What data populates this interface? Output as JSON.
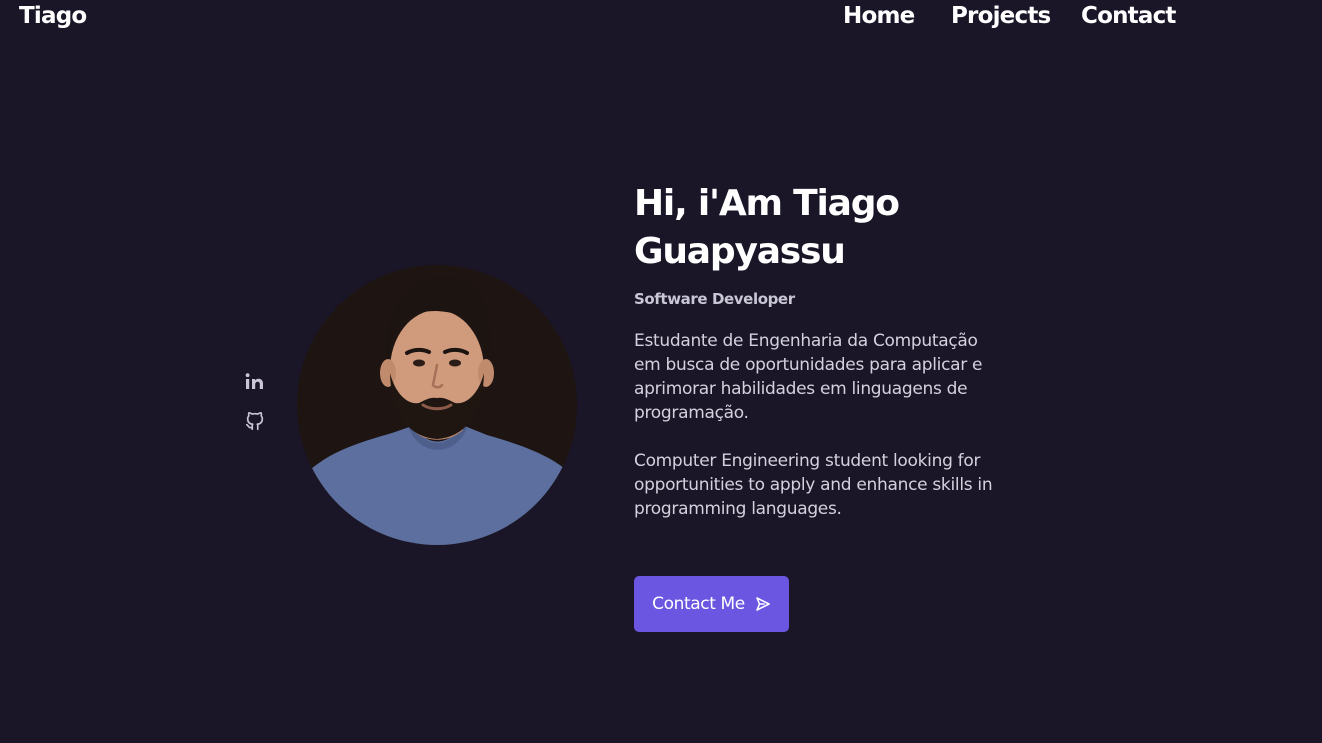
{
  "header": {
    "brand": "Tiago",
    "nav": {
      "home": "Home",
      "projects": "Projects",
      "contact": "Contact"
    }
  },
  "social": [
    {
      "icon": "linkedin-icon"
    },
    {
      "icon": "github-icon"
    }
  ],
  "hero": {
    "title": "Hi, i'Am Tiago Guapyassu",
    "subtitle": "Software Developer",
    "description_pt": "Estudante de Engenharia da Computação em busca de oportunidades para aplicar e aprimorar habilidades em linguagens de programação.",
    "description_en": "Computer Engineering student looking for opportunities to apply and enhance skills in programming languages.",
    "cta_label": "Contact Me",
    "cta_icon": "send-icon"
  },
  "colors": {
    "background": "#1a1628",
    "accent": "#6a56e0",
    "text": "#ffffff",
    "muted_text": "#d4d1de"
  }
}
